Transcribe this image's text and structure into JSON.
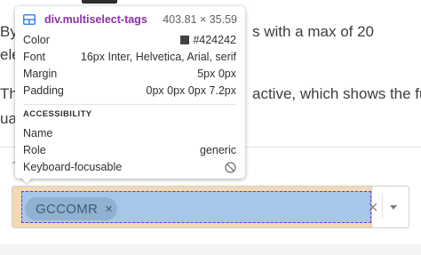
{
  "background": {
    "line1_left": "By",
    "line1_right": "s with a max of 20",
    "line2_left": "ele",
    "line3_left": "Thi",
    "line3_right": "active, which shows the fu",
    "line4_left": "ua"
  },
  "multiselect": {
    "tags": [
      {
        "label": "GCCOMR",
        "remove": "×"
      }
    ],
    "clear_icon": "×"
  },
  "inspector": {
    "selector": "div.multiselect-tags",
    "dimensions": "403.81 × 35.59",
    "props": [
      {
        "key": "Color",
        "value": "#424242",
        "swatch": "#424242"
      },
      {
        "key": "Font",
        "value": "16px Inter, Helvetica, Arial, serif"
      },
      {
        "key": "Margin",
        "value": "5px 0px"
      },
      {
        "key": "Padding",
        "value": "0px 0px 0px 7.2px"
      }
    ],
    "accessibility_title": "ACCESSIBILITY",
    "accessibility": [
      {
        "key": "Name",
        "value": ""
      },
      {
        "key": "Role",
        "value": "generic"
      },
      {
        "key": "Keyboard-focusable",
        "icon": "not-allowed-icon"
      }
    ]
  }
}
